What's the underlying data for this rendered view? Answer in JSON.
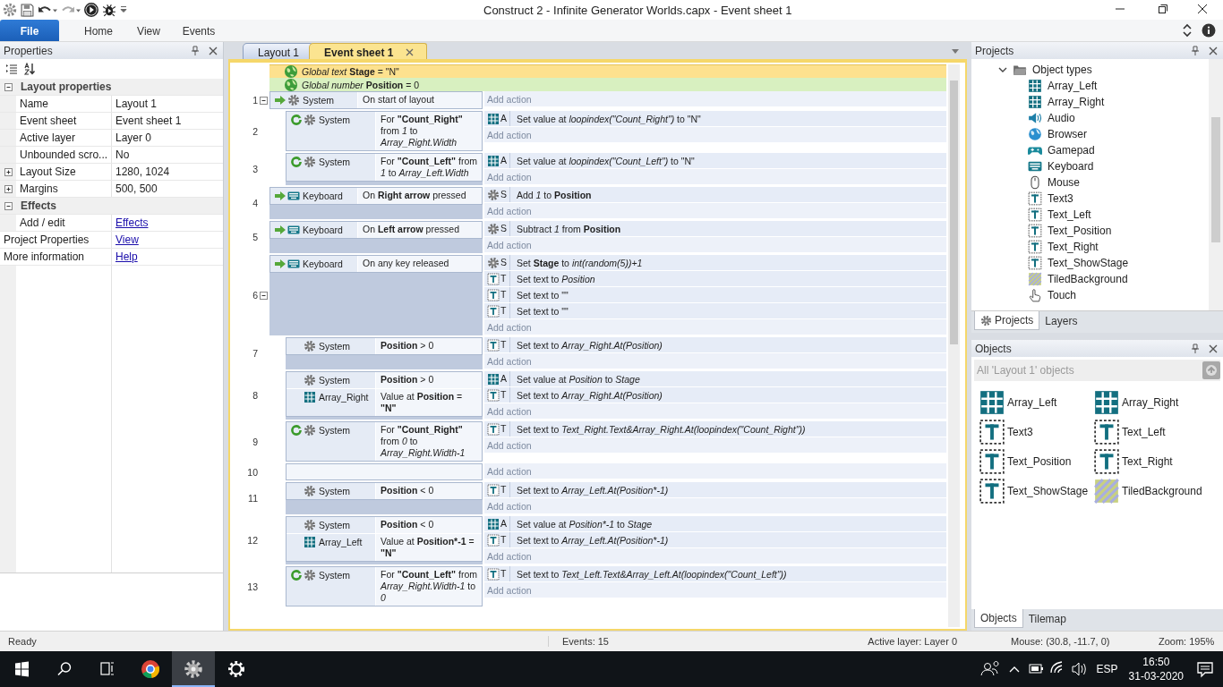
{
  "window": {
    "title": "Construct 2 - Infinite Generator Worlds.capx - Event sheet 1"
  },
  "ribbon_tabs": [
    {
      "label": "File",
      "kind": "file"
    },
    {
      "label": "Home",
      "kind": "tab"
    },
    {
      "label": "View",
      "kind": "tab"
    },
    {
      "label": "Events",
      "kind": "tab"
    }
  ],
  "properties_panel": {
    "title": "Properties",
    "sections": [
      {
        "label": "Layout properties",
        "expanded": true,
        "rows": [
          {
            "name": "Name",
            "value": "Layout 1",
            "kind": "value"
          },
          {
            "name": "Event sheet",
            "value": "Event sheet 1",
            "kind": "value"
          },
          {
            "name": "Active layer",
            "value": "Layer 0",
            "kind": "value"
          },
          {
            "name": "Unbounded scro...",
            "value": "No",
            "kind": "value"
          },
          {
            "name": "Layout Size",
            "value": "1280, 1024",
            "kind": "group"
          },
          {
            "name": "Margins",
            "value": "500, 500",
            "kind": "group"
          }
        ]
      },
      {
        "label": "Effects",
        "expanded": true,
        "rows": [
          {
            "name": "Add / edit",
            "value": "Effects",
            "kind": "link"
          }
        ]
      }
    ],
    "extra_rows": [
      {
        "name": "Project Properties",
        "value": "View",
        "kind": "link"
      },
      {
        "name": "More information",
        "value": "Help",
        "kind": "link"
      }
    ]
  },
  "doc_tabs": [
    {
      "label": "Layout 1",
      "selected": false
    },
    {
      "label": "Event sheet 1",
      "selected": true
    }
  ],
  "event_sheet": {
    "globals": [
      {
        "kind": "text",
        "parts": [
          {
            "t": "Global text ",
            "i": true
          },
          {
            "t": "Stage",
            "b": true
          },
          {
            "t": " = \"N\""
          }
        ]
      },
      {
        "kind": "number",
        "parts": [
          {
            "t": "Global number ",
            "i": true
          },
          {
            "t": "Position",
            "b": true
          },
          {
            "t": " = 0"
          }
        ]
      }
    ],
    "events": [
      {
        "number": "1",
        "expanded": true,
        "conditions": [
          {
            "kind": "systemtrigger",
            "object": "System",
            "parts": [
              {
                "t": "On start of layout"
              }
            ]
          }
        ],
        "add_action": "Add action",
        "children": [
          {
            "number": "2",
            "conditions": [
              {
                "kind": "systemloop",
                "object": "System",
                "parts": [
                  {
                    "t": "For "
                  },
                  {
                    "t": "\"Count_Right\"",
                    "b": true
                  },
                  {
                    "t": " from "
                  },
                  {
                    "t": "1",
                    "i": true
                  },
                  {
                    "t": " to "
                  },
                  {
                    "t": "Array_Right.Width",
                    "i": true
                  }
                ]
              }
            ],
            "actions": [
              {
                "kind": "array",
                "object": "A",
                "parts": [
                  {
                    "t": "Set value at "
                  },
                  {
                    "t": "loopindex(\"Count_Right\")",
                    "i": true
                  },
                  {
                    "t": "  to \"N\""
                  }
                ]
              }
            ],
            "add_action": "Add action"
          },
          {
            "number": "3",
            "conditions": [
              {
                "kind": "systemloop",
                "object": "System",
                "parts": [
                  {
                    "t": "For "
                  },
                  {
                    "t": "\"Count_Left\"",
                    "b": true
                  },
                  {
                    "t": " from "
                  },
                  {
                    "t": "1",
                    "i": true
                  },
                  {
                    "t": " to "
                  },
                  {
                    "t": "Array_Left.Width",
                    "i": true
                  }
                ]
              }
            ],
            "actions": [
              {
                "kind": "array",
                "object": "A",
                "parts": [
                  {
                    "t": "Set value at "
                  },
                  {
                    "t": "loopindex(\"Count_Left\")",
                    "i": true
                  },
                  {
                    "t": "  to \"N\""
                  }
                ]
              }
            ],
            "add_action": "Add action"
          }
        ]
      },
      {
        "number": "4",
        "conditions": [
          {
            "kind": "keytrigger",
            "object": "Keyboard",
            "parts": [
              {
                "t": "On "
              },
              {
                "t": "Right arrow",
                "b": true
              },
              {
                "t": " pressed"
              }
            ]
          }
        ],
        "actions": [
          {
            "kind": "system",
            "object": "S",
            "parts": [
              {
                "t": "Add "
              },
              {
                "t": "1",
                "i": true
              },
              {
                "t": " to "
              },
              {
                "t": "Position",
                "b": true
              }
            ]
          }
        ],
        "add_action": "Add action"
      },
      {
        "number": "5",
        "conditions": [
          {
            "kind": "keytrigger",
            "object": "Keyboard",
            "parts": [
              {
                "t": "On "
              },
              {
                "t": "Left arrow",
                "b": true
              },
              {
                "t": " pressed"
              }
            ]
          }
        ],
        "actions": [
          {
            "kind": "system",
            "object": "S",
            "parts": [
              {
                "t": "Subtract "
              },
              {
                "t": "1",
                "i": true
              },
              {
                "t": " from "
              },
              {
                "t": "Position",
                "b": true
              }
            ]
          }
        ],
        "add_action": "Add action"
      },
      {
        "number": "6",
        "expanded": true,
        "conditions": [
          {
            "kind": "keytrigger",
            "object": "Keyboard",
            "parts": [
              {
                "t": "On any key released"
              }
            ]
          }
        ],
        "actions": [
          {
            "kind": "system",
            "object": "S",
            "parts": [
              {
                "t": "Set "
              },
              {
                "t": "Stage",
                "b": true
              },
              {
                "t": " to "
              },
              {
                "t": "int(random(5))+1",
                "i": true
              }
            ]
          },
          {
            "kind": "text",
            "object": "T",
            "parts": [
              {
                "t": "Set text to "
              },
              {
                "t": "Position",
                "i": true
              }
            ]
          },
          {
            "kind": "text",
            "object": "T",
            "parts": [
              {
                "t": "Set text to \"\""
              }
            ]
          },
          {
            "kind": "text",
            "object": "T",
            "parts": [
              {
                "t": "Set text to \"\""
              }
            ]
          }
        ],
        "add_action": "Add action",
        "children": [
          {
            "number": "7",
            "conditions": [
              {
                "kind": "system",
                "object": "System",
                "parts": [
                  {
                    "t": "Position",
                    "b": true
                  },
                  {
                    "t": " > 0"
                  }
                ]
              }
            ],
            "actions": [
              {
                "kind": "text",
                "object": "T",
                "parts": [
                  {
                    "t": "Set text to "
                  },
                  {
                    "t": "Array_Right.At(Position)",
                    "i": true
                  }
                ]
              }
            ],
            "add_action": "Add action"
          },
          {
            "number": "8",
            "conditions": [
              {
                "kind": "system",
                "object": "System",
                "parts": [
                  {
                    "t": "Position",
                    "b": true
                  },
                  {
                    "t": " > 0"
                  }
                ]
              },
              {
                "kind": "array",
                "object": "Array_Right",
                "parts": [
                  {
                    "t": "Value at "
                  },
                  {
                    "t": "Position",
                    "b": true
                  },
                  {
                    "t": " = "
                  },
                  {
                    "t": "\"N\"",
                    "b": true
                  }
                ]
              }
            ],
            "actions": [
              {
                "kind": "array",
                "object": "A",
                "parts": [
                  {
                    "t": "Set value at "
                  },
                  {
                    "t": "Position",
                    "i": true
                  },
                  {
                    "t": "  to "
                  },
                  {
                    "t": "Stage",
                    "i": true
                  }
                ]
              },
              {
                "kind": "text",
                "object": "T",
                "parts": [
                  {
                    "t": "Set text to "
                  },
                  {
                    "t": "Array_Right.At(Position)",
                    "i": true
                  }
                ]
              }
            ],
            "add_action": "Add action"
          },
          {
            "number": "9",
            "conditions": [
              {
                "kind": "systemloop",
                "object": "System",
                "parts": [
                  {
                    "t": "For "
                  },
                  {
                    "t": "\"Count_Right\"",
                    "b": true
                  },
                  {
                    "t": " from "
                  },
                  {
                    "t": "0",
                    "i": true
                  },
                  {
                    "t": " to "
                  },
                  {
                    "t": "Array_Right.Width-1",
                    "i": true
                  }
                ]
              }
            ],
            "actions": [
              {
                "kind": "text",
                "object": "T",
                "parts": [
                  {
                    "t": "Set text to "
                  },
                  {
                    "t": "Text_Right.Text&Array_Right.At(loopindex(\"Count_Right\"))",
                    "i": true
                  }
                ]
              }
            ],
            "add_action": "Add action"
          },
          {
            "number": "10",
            "add_action": "Add action"
          },
          {
            "number": "11",
            "conditions": [
              {
                "kind": "system",
                "object": "System",
                "parts": [
                  {
                    "t": "Position",
                    "b": true
                  },
                  {
                    "t": " < 0"
                  }
                ]
              }
            ],
            "actions": [
              {
                "kind": "text",
                "object": "T",
                "parts": [
                  {
                    "t": "Set text to "
                  },
                  {
                    "t": "Array_Left.At(Position*-1)",
                    "i": true
                  }
                ]
              }
            ],
            "add_action": "Add action"
          },
          {
            "number": "12",
            "conditions": [
              {
                "kind": "system",
                "object": "System",
                "parts": [
                  {
                    "t": "Position",
                    "b": true
                  },
                  {
                    "t": " < 0"
                  }
                ]
              },
              {
                "kind": "array",
                "object": "Array_Left",
                "parts": [
                  {
                    "t": "Value at "
                  },
                  {
                    "t": "Position*-1",
                    "b": true
                  },
                  {
                    "t": " = "
                  },
                  {
                    "t": "\"N\"",
                    "b": true
                  }
                ]
              }
            ],
            "actions": [
              {
                "kind": "array",
                "object": "A",
                "parts": [
                  {
                    "t": "Set value at "
                  },
                  {
                    "t": "Position*-1",
                    "i": true
                  },
                  {
                    "t": "  to "
                  },
                  {
                    "t": "Stage",
                    "i": true
                  }
                ]
              },
              {
                "kind": "text",
                "object": "T",
                "parts": [
                  {
                    "t": "Set text to "
                  },
                  {
                    "t": "Array_Left.At(Position*-1)",
                    "i": true
                  }
                ]
              }
            ],
            "add_action": "Add action"
          },
          {
            "number": "13",
            "conditions": [
              {
                "kind": "systemloop",
                "object": "System",
                "parts": [
                  {
                    "t": "For "
                  },
                  {
                    "t": "\"Count_Left\"",
                    "b": true
                  },
                  {
                    "t": " from "
                  },
                  {
                    "t": "Array_Right.Width-1",
                    "i": true
                  },
                  {
                    "t": "  to "
                  },
                  {
                    "t": "0",
                    "i": true
                  }
                ]
              }
            ],
            "actions": [
              {
                "kind": "text",
                "object": "T",
                "parts": [
                  {
                    "t": "Set text to "
                  },
                  {
                    "t": "Text_Left.Text&Array_Left.At(loopindex(\"Count_Left\"))",
                    "i": true
                  }
                ]
              }
            ],
            "add_action": "Add action"
          }
        ]
      }
    ]
  },
  "projects_panel": {
    "title": "Projects",
    "folder": {
      "label": "Object types",
      "expanded": true,
      "children": [
        {
          "label": "Array_Left",
          "kind": "array"
        },
        {
          "label": "Array_Right",
          "kind": "array"
        },
        {
          "label": "Audio",
          "kind": "audio"
        },
        {
          "label": "Browser",
          "kind": "browser"
        },
        {
          "label": "Gamepad",
          "kind": "gamepad"
        },
        {
          "label": "Keyboard",
          "kind": "keyboard"
        },
        {
          "label": "Mouse",
          "kind": "mouse"
        },
        {
          "label": "Text3",
          "kind": "text"
        },
        {
          "label": "Text_Left",
          "kind": "text"
        },
        {
          "label": "Text_Position",
          "kind": "text"
        },
        {
          "label": "Text_Right",
          "kind": "text"
        },
        {
          "label": "Text_ShowStage",
          "kind": "text"
        },
        {
          "label": "TiledBackground",
          "kind": "tiled"
        },
        {
          "label": "Touch",
          "kind": "touch"
        }
      ]
    },
    "tabs": [
      {
        "label": "Projects",
        "selected": true
      },
      {
        "label": "Layers",
        "selected": false
      }
    ]
  },
  "objects_panel": {
    "title": "Objects",
    "filter": "All 'Layout 1' objects",
    "items": [
      {
        "label": "Array_Left",
        "kind": "array"
      },
      {
        "label": "Array_Right",
        "kind": "array"
      },
      {
        "label": "Text3",
        "kind": "text"
      },
      {
        "label": "Text_Left",
        "kind": "text"
      },
      {
        "label": "Text_Position",
        "kind": "text"
      },
      {
        "label": "Text_Right",
        "kind": "text"
      },
      {
        "label": "Text_ShowStage",
        "kind": "text"
      },
      {
        "label": "TiledBackground",
        "kind": "tiled"
      }
    ],
    "tabs": [
      {
        "label": "Objects",
        "selected": true
      },
      {
        "label": "Tilemap",
        "selected": false
      }
    ]
  },
  "status_bar": {
    "message": "Ready",
    "events": "Events: 15",
    "active_layer": "Active layer: Layer 0",
    "mouse": "Mouse: (30.8, -11.7, 0)",
    "zoom": "Zoom: 195%"
  },
  "taskbar": {
    "apps": [
      {
        "kind": "chrome",
        "selected": false
      },
      {
        "kind": "construct",
        "selected": true
      },
      {
        "kind": "settings",
        "selected": false
      }
    ],
    "language": "ESP",
    "time": "16:50",
    "date": "31-03-2020"
  }
}
